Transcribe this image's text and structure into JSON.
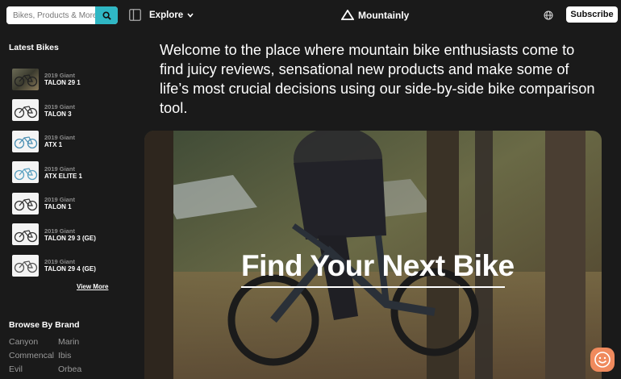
{
  "header": {
    "search_placeholder": "Bikes, Products & More",
    "explore_label": "Explore",
    "logo_text": "Mountainly",
    "subscribe_label": "Subscribe"
  },
  "sidebar": {
    "latest_heading": "Latest Bikes",
    "bikes": [
      {
        "year": "2019 Giant",
        "model": "TALON 29 1"
      },
      {
        "year": "2019 Giant",
        "model": "TALON 3"
      },
      {
        "year": "2019 Giant",
        "model": "ATX 1"
      },
      {
        "year": "2019 Giant",
        "model": "ATX ELITE 1"
      },
      {
        "year": "2019 Giant",
        "model": "TALON 1"
      },
      {
        "year": "2019 Giant",
        "model": "TALON 29 3 (GE)"
      },
      {
        "year": "2019 Giant",
        "model": "TALON 29 4 (GE)"
      }
    ],
    "view_more_label": "View More",
    "brand_heading": "Browse By Brand",
    "brands": [
      "Canyon",
      "Marin",
      "Commencal",
      "Ibis",
      "Evil",
      "Orbea"
    ]
  },
  "main": {
    "intro_text": "Welcome to the place where mountain bike enthusiasts come to find juicy reviews, sensational new products and make some of life’s most crucial decisions using our side-by-side bike comparison tool.",
    "hero_title": "Find Your Next Bike"
  },
  "colors": {
    "background": "#1a1a1a",
    "accent": "#2fb7c4",
    "chat": "#f08a5d"
  }
}
